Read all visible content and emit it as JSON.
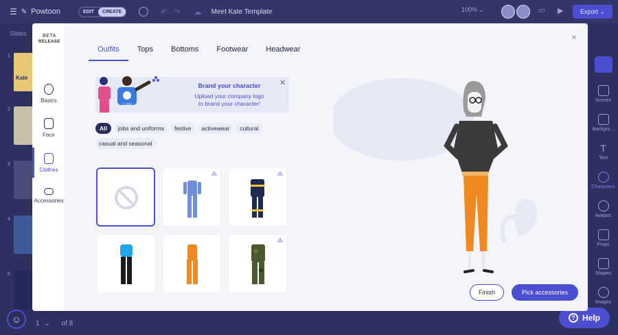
{
  "app": {
    "brand": "Powtoon",
    "mode_edit": "EDIT",
    "mode_create": "CREATE",
    "title": "Meet Kate Template",
    "zoom": "100%",
    "export_label": "Export"
  },
  "slides_panel": {
    "label": "Slides",
    "numbers": [
      "1",
      "2",
      "3",
      "4",
      "5"
    ],
    "thumb_text": "Kate"
  },
  "right_sidebar": {
    "items": [
      "Scenes",
      "Backgro...",
      "Text",
      "Characters",
      "Avatars",
      "Props",
      "Shapes",
      "Images"
    ],
    "active": "Characters"
  },
  "pager": {
    "current": "1",
    "total_text": "of 8"
  },
  "help_label": "Help",
  "modal": {
    "beta_top": "BETA",
    "beta_bottom": "RELEASE",
    "nav": [
      "Basics",
      "Face",
      "Clothes",
      "Accessories"
    ],
    "nav_active": "Clothes",
    "tabs": [
      "Outfits",
      "Tops",
      "Bottoms",
      "Footwear",
      "Headwear"
    ],
    "tab_active": "Outfits",
    "banner": {
      "title": "Brand your character",
      "subtitle_line1": "Upload your company logo",
      "subtitle_line2": "to brand your character!",
      "logo_text": "Logo"
    },
    "filters": [
      "All",
      "jobs and uniforms",
      "festive",
      "activewear",
      "cultural",
      "casual and seasonal"
    ],
    "filter_active": "All",
    "outfits": [
      {
        "name": "none",
        "color": "#d6d8e6",
        "premium": false
      },
      {
        "name": "blue jumpsuit",
        "color": "#6f8fd8",
        "premium": true
      },
      {
        "name": "firefighter uniform",
        "color": "#1e2a4f",
        "premium": true
      },
      {
        "name": "blue top black pants",
        "color": "#1fa6e6",
        "premium": false
      },
      {
        "name": "orange jumpsuit",
        "color": "#f0891f",
        "premium": false
      },
      {
        "name": "camouflage uniform",
        "color": "#4a5a2e",
        "premium": true
      }
    ],
    "finish_label": "Finish",
    "pick_label": "Pick accessories"
  },
  "colors": {
    "accent": "#4b4ed0",
    "shirt": "#3b3b3b",
    "pants": "#f0891f",
    "hair": "#9a9a9a",
    "skin": "#f2f2f2"
  }
}
